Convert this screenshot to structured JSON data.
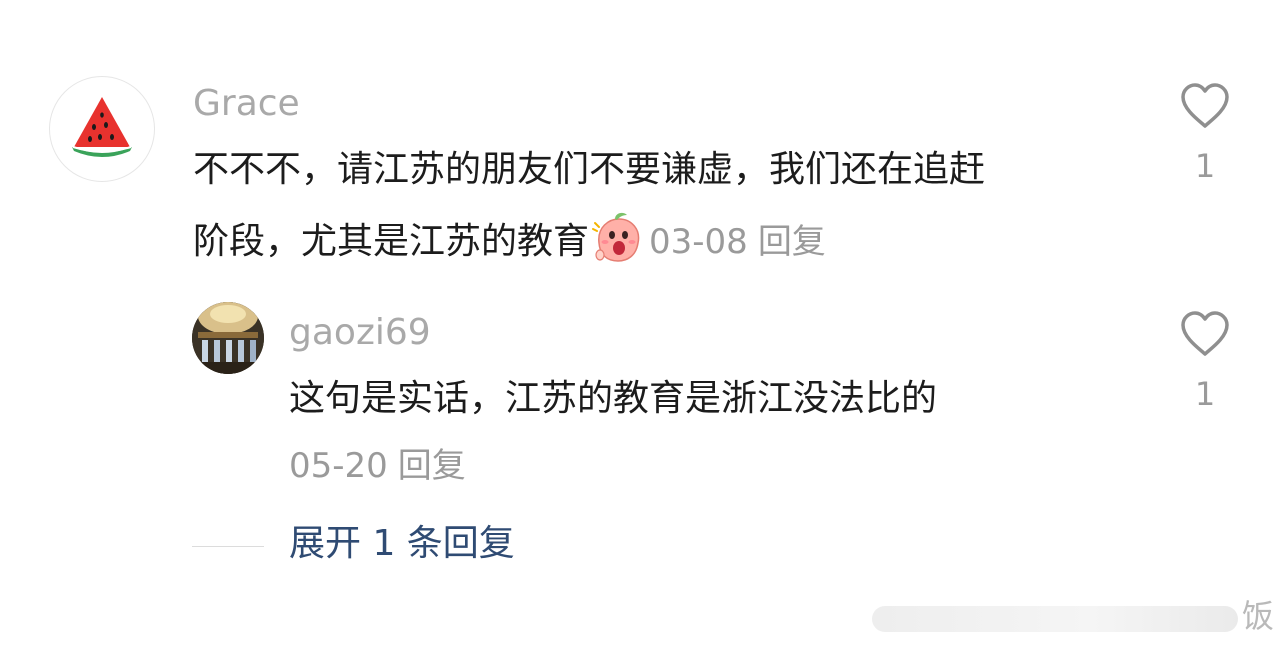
{
  "comment": {
    "username": "Grace",
    "text_line1": "不不不，请江苏的朋友们不要谦虚，我们还在追赶",
    "text_line2": "阶段，尤其是江苏的教育",
    "emoji": "surprised-peach-emoji",
    "date": "03-08",
    "reply_label": "回复",
    "likes": "1",
    "avatar_icon": "watermelon-icon"
  },
  "reply": {
    "username": "gaozi69",
    "text": "这句是实话，江苏的教育是浙江没法比的",
    "date": "05-20",
    "reply_label": "回复",
    "likes": "1",
    "avatar_icon": "dome-interior-photo"
  },
  "expand_replies": "展开 1 条回复",
  "watermark": "饭",
  "colors": {
    "username": "#a9a9a9",
    "text": "#1c1c1c",
    "meta": "#9a9a9a",
    "link": "#2f4b73",
    "watermelon_red": "#e8322e",
    "watermelon_green": "#3aa35a"
  }
}
